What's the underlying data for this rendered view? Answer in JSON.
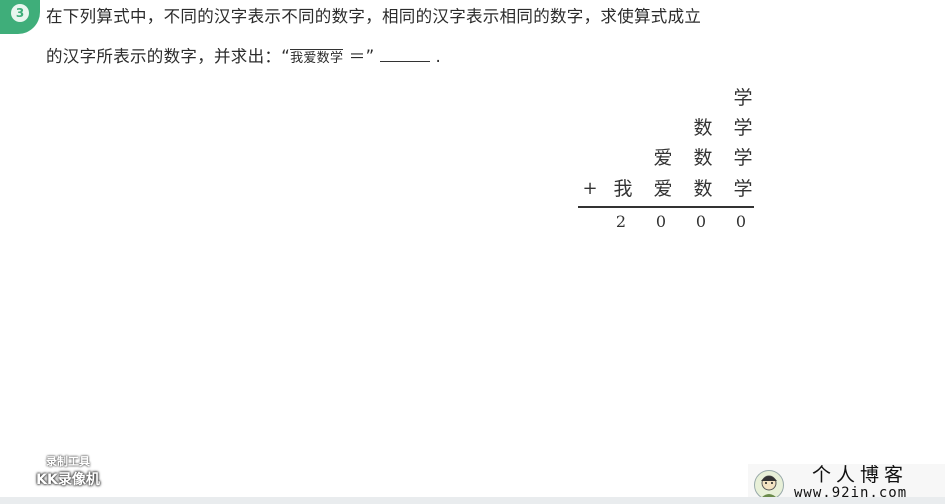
{
  "question": {
    "number": "3",
    "line1": "在下列算式中，不同的汉字表示不同的数字，相同的汉字表示相同的数字，求使算式成立",
    "line2_before": "的汉字所表示的数字，并求出：“",
    "overline_word": "我爱数学",
    "line2_eq": " ＝” ",
    "line2_after": "  ."
  },
  "puzzle": {
    "rows": [
      [
        "",
        "",
        "",
        "学"
      ],
      [
        "",
        "",
        "数",
        "学"
      ],
      [
        "",
        "爱",
        "数",
        "学"
      ],
      [
        "我",
        "爱",
        "数",
        "学"
      ]
    ],
    "operator": "+",
    "sum": [
      "2",
      "0",
      "0",
      "0"
    ]
  },
  "watermark_left": {
    "line1": "录制工具",
    "line2": "KK录像机"
  },
  "watermark_right": {
    "title": "个人博客",
    "url": "www.92in.com"
  },
  "colors": {
    "accent": "#3fae7a"
  }
}
